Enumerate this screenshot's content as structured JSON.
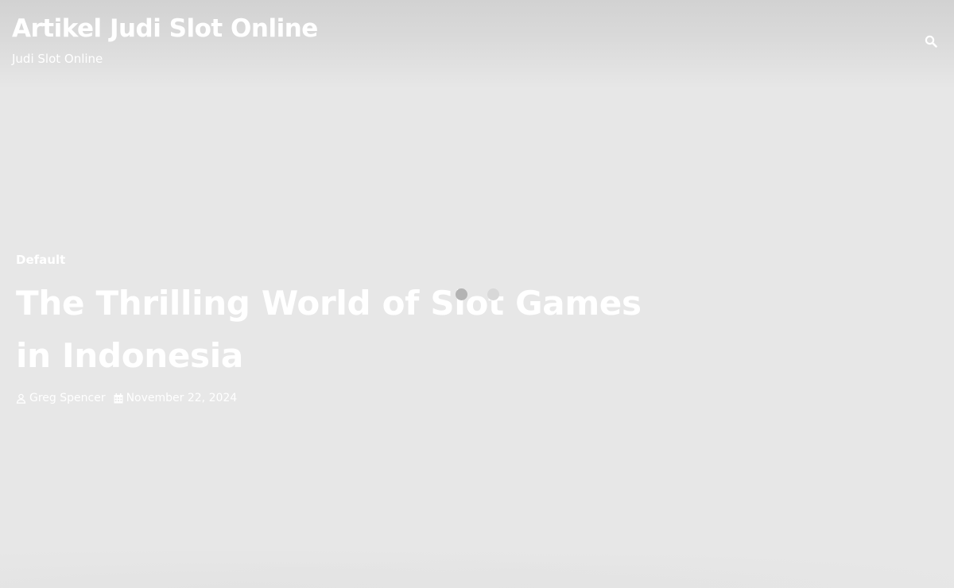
{
  "site": {
    "title": "Artikel Judi Slot Online",
    "tagline": "Judi Slot Online"
  },
  "header": {
    "search_icon": "search-icon"
  },
  "post": {
    "category": "Default",
    "title": "The Thrilling World of Slot Games in Indonesia",
    "author": "Greg Spencer",
    "date": "November 22, 2024",
    "author_icon": "user-icon",
    "date_icon": "calendar-icon"
  },
  "colors": {
    "background": "#e7e7e7",
    "header_top": "#d2d2d2",
    "text": "#ffffff",
    "loader_dot_dark": "#b3b3b3",
    "loader_dot_light": "#d8d8d8"
  }
}
